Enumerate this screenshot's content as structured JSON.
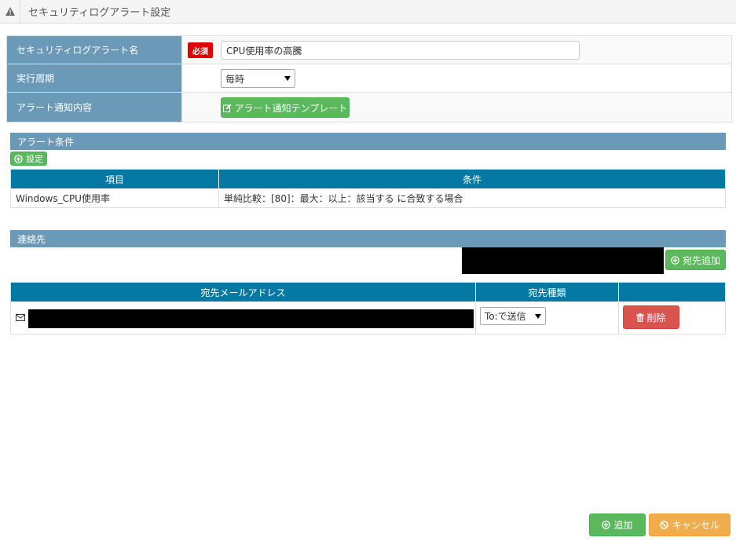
{
  "header": {
    "title": "セキュリティログアラート設定"
  },
  "form": {
    "name_label": "セキュリティログアラート名",
    "required_badge": "必須",
    "name_value": "CPU使用率の高騰",
    "period_label": "実行周期",
    "period_value": "毎時",
    "notify_label": "アラート通知内容",
    "template_button": "アラート通知テンプレート"
  },
  "conditions": {
    "section_title": "アラート条件",
    "settings_button": "設定",
    "columns": [
      "項目",
      "条件"
    ],
    "rows": [
      {
        "item": "Windows_CPU使用率",
        "condition": "単純比較：[80]：最大：以上：該当する に合致する場合"
      }
    ]
  },
  "contacts": {
    "section_title": "連絡先",
    "add_recipient_button": "宛先追加",
    "columns": [
      "宛先メールアドレス",
      "宛先種類",
      ""
    ],
    "rows": [
      {
        "send_type": "To:で送信",
        "delete_button": "削除"
      }
    ]
  },
  "footer": {
    "add_button": "追加",
    "cancel_button": "キャンセル"
  },
  "colors": {
    "label_bg": "#6b9ab8",
    "grid_header": "#0579a4",
    "success": "#5cb85c",
    "danger": "#d9534f",
    "warning": "#f0ad4e",
    "required": "#e00000"
  },
  "icons": {
    "title": "warning-icon",
    "template": "edit-icon",
    "settings": "plus-circle-icon",
    "recipient": "envelope-icon",
    "delete": "trash-icon",
    "cancel": "ban-icon"
  }
}
